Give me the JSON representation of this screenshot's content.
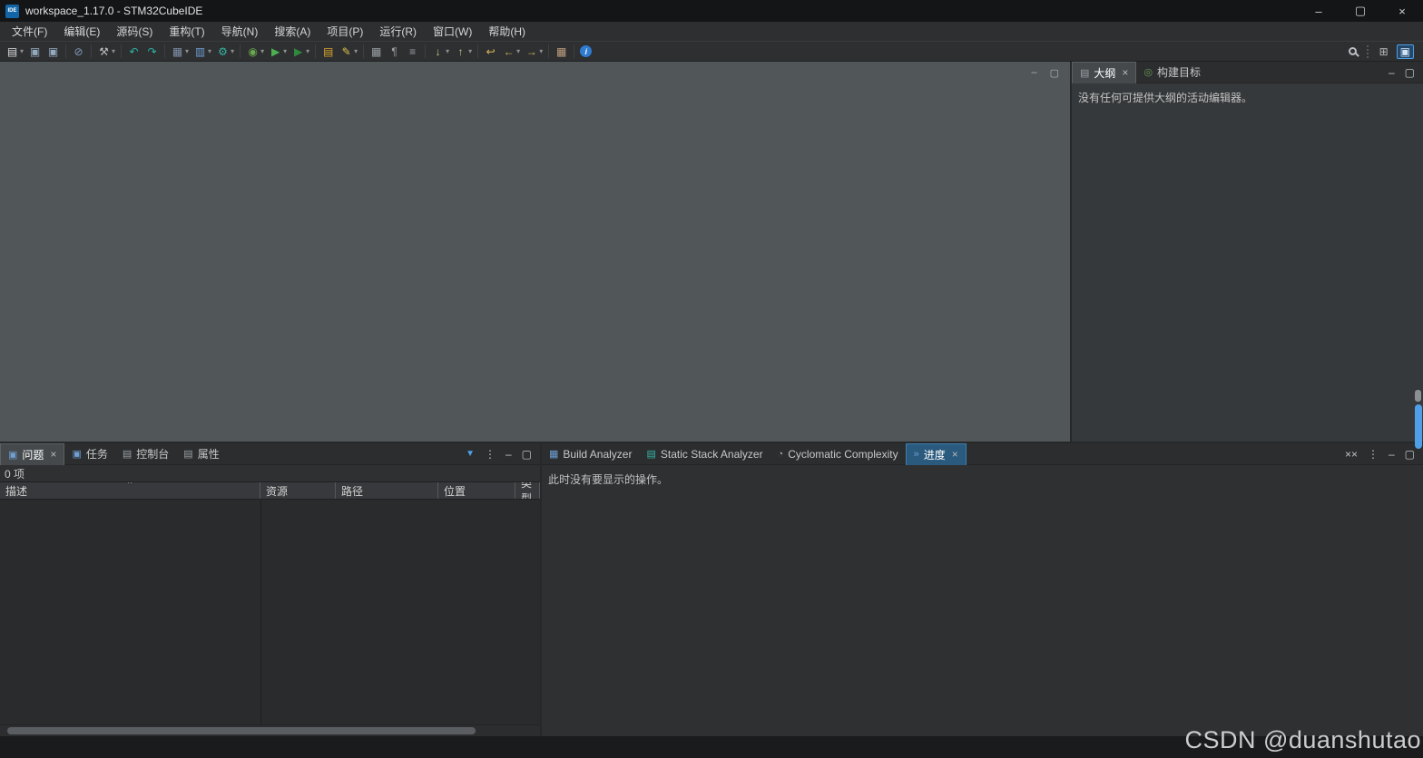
{
  "theme": {
    "titlebar-bg": "#141517",
    "bar-bg": "#2e2f31",
    "window-bg": "#26282a",
    "editor-bg": "#515658",
    "panel-bg": "#36393b",
    "panel2-bg": "#2e3032",
    "tabstrip-bg": "#2b2d2f",
    "tab-selected-bg": "#45494c",
    "tab-selected-blue": "#2a5a7e",
    "table-header-bg": "#37393c",
    "table-body-bg": "#292b2d",
    "statusbar-bg": "#1a1b1d",
    "text": "#cccccc",
    "accent-blue": "#4f9fe8"
  },
  "glyphs": {
    "close": "×",
    "minimize": "–",
    "maximize": "▢",
    "menu_dots": "⋮",
    "dropdown": "▾"
  },
  "window": {
    "title": "workspace_1.17.0 - STM32CubeIDE",
    "logo_text": "IDE"
  },
  "menus": [
    "文件(F)",
    "编辑(E)",
    "源码(S)",
    "重构(T)",
    "导航(N)",
    "搜索(A)",
    "项目(P)",
    "运行(R)",
    "窗口(W)",
    "帮助(H)"
  ],
  "toolbar": {
    "icons": [
      {
        "name": "new-wizard",
        "glyph": "▤"
      },
      {
        "name": "save",
        "glyph": "▣"
      },
      {
        "name": "save-all",
        "glyph": "▣"
      },
      {
        "name": "skip-all-breakpoints",
        "glyph": "⊘"
      },
      {
        "name": "build",
        "glyph": "⚒"
      },
      {
        "name": "undo",
        "glyph": "↶"
      },
      {
        "name": "redo",
        "glyph": "↷"
      },
      {
        "name": "device-configuration",
        "glyph": "▦"
      },
      {
        "name": "new-stm32-project",
        "glyph": "▥"
      },
      {
        "name": "generate-code",
        "glyph": "⚙"
      },
      {
        "name": "debug",
        "glyph": "◉"
      },
      {
        "name": "run",
        "glyph": "▶"
      },
      {
        "name": "external-tools",
        "glyph": "▶"
      },
      {
        "name": "open-element",
        "glyph": "▤"
      },
      {
        "name": "toggle-highlight",
        "glyph": "✎"
      },
      {
        "name": "new-window",
        "glyph": "▦"
      },
      {
        "name": "show-whitespace",
        "glyph": "¶"
      },
      {
        "name": "word-wrap",
        "glyph": "≡"
      },
      {
        "name": "next-annotation",
        "glyph": "↓"
      },
      {
        "name": "previous-annotation",
        "glyph": "↑"
      },
      {
        "name": "last-edit-location",
        "glyph": "↩"
      },
      {
        "name": "back",
        "glyph": "←"
      },
      {
        "name": "forward",
        "glyph": "→"
      },
      {
        "name": "pin-editor",
        "glyph": "▦"
      },
      {
        "name": "info",
        "glyph": "i"
      }
    ],
    "right": {
      "open_perspective_glyph": "⊞",
      "active_perspective_glyph": "▣"
    }
  },
  "outline_panel": {
    "tabs": [
      {
        "label": "大纲",
        "icon": "▤"
      },
      {
        "label": "构建目标",
        "icon": "◎"
      }
    ],
    "empty_message": "没有任何可提供大纲的活动编辑器。"
  },
  "problems_panel": {
    "tabs": [
      {
        "label": "问题",
        "icon": "▣"
      },
      {
        "label": "任务",
        "icon": "▣"
      },
      {
        "label": "控制台",
        "icon": "▤"
      },
      {
        "label": "属性",
        "icon": "▤"
      }
    ],
    "count_text": "0 项",
    "columns": [
      "描述",
      "资源",
      "路径",
      "位置",
      "类型"
    ],
    "sort_glyph": "^",
    "filter_glyph": "▼"
  },
  "analyzer_panel": {
    "tabs": [
      {
        "label": "Build Analyzer",
        "icon": "▦"
      },
      {
        "label": "Static Stack Analyzer",
        "icon": "▤"
      },
      {
        "label": "Cyclomatic Complexity",
        "icon": "◔"
      },
      {
        "label": "进度",
        "icon": "»"
      }
    ],
    "empty_message": "此时没有要显示的操作。",
    "remove_all_glyph": "××"
  },
  "watermark": "CSDN @duanshutao"
}
